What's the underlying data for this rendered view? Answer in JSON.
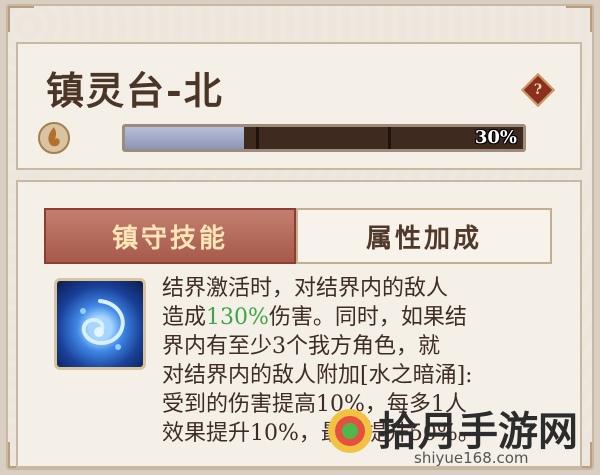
{
  "header": {
    "title": "镇灵台-北",
    "help_label": "?",
    "progress": {
      "value": 0.3,
      "text": "30%"
    }
  },
  "tabs": [
    {
      "label": "镇守技能",
      "active": true
    },
    {
      "label": "属性加成",
      "active": false
    }
  ],
  "skill": {
    "icon": "water-orb-icon",
    "desc_before": "结界激活时，对结界内的敌人\n造成",
    "desc_highlight": "130%",
    "desc_after": "伤害。同时，如果结\n界内有至少3个我方角色，就\n对结界内的敌人附加[水之暗涌]:\n受到的伤害提高10%，每多1人\n效果提升10%，最多提升50%。"
  },
  "watermark": {
    "text": "拾月手游网",
    "url": "shiyue168.com"
  },
  "colors": {
    "accent": "#a65a4b",
    "highlight": "#3ea548",
    "progress_fill": "#b7bfd8",
    "progress_track": "#3e2a1f"
  }
}
